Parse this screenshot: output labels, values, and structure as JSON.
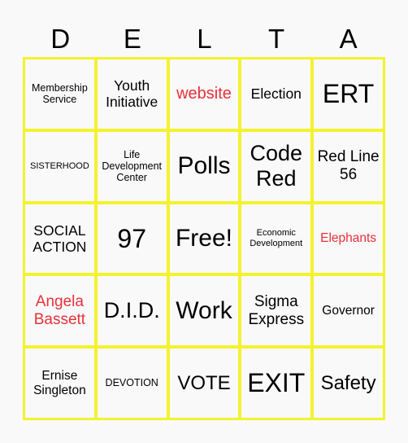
{
  "header": {
    "letters": [
      "D",
      "E",
      "L",
      "T",
      "A"
    ]
  },
  "colors": {
    "border": "#f2f230",
    "background": "#f9f9f9",
    "red_text": "#e8303a",
    "text": "#000000"
  },
  "board": {
    "cells": [
      [
        "Membership Service",
        "Youth Initiative",
        "website",
        "Election",
        "ERT"
      ],
      [
        "SISTERHOOD",
        "Life Development Center",
        "Polls",
        "Code Red",
        "Red Line 56"
      ],
      [
        "SOCIAL ACTION",
        "97",
        "Free!",
        "Economic Development",
        "Elephants"
      ],
      [
        "Angela Bassett",
        "D.I.D.",
        "Work",
        "Sigma Express",
        "Governor"
      ],
      [
        "Ernise Singleton",
        "DEVOTION",
        "VOTE",
        "EXIT",
        "Safety"
      ]
    ],
    "red_cells": [
      "website",
      "Elephants",
      "Angela Bassett"
    ]
  }
}
